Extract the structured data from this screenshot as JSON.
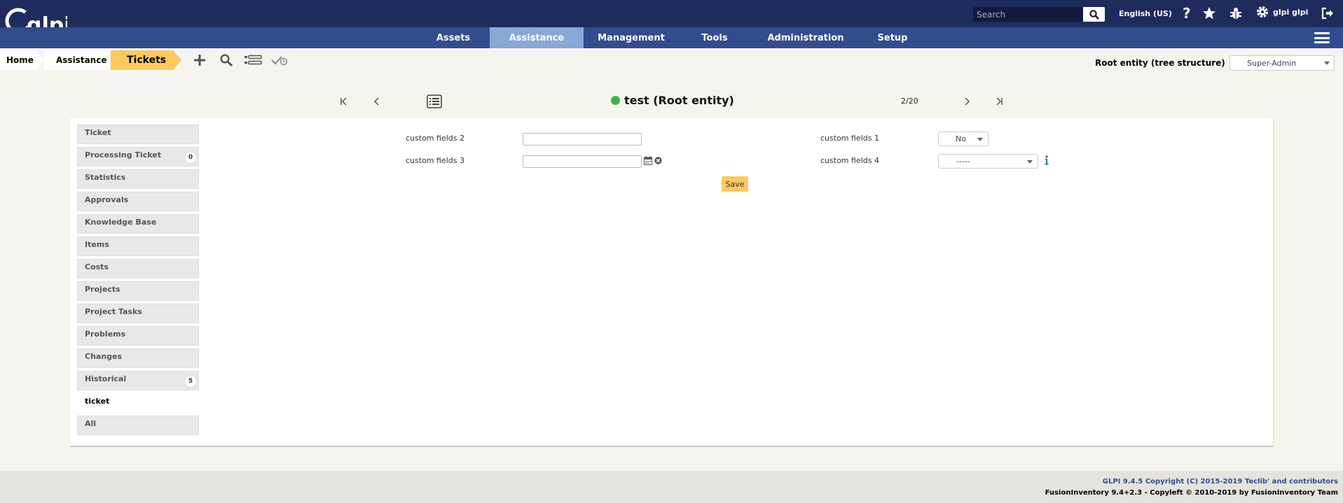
{
  "app": {
    "logo_text": "glpi"
  },
  "top": {
    "search_placeholder": "Search",
    "language": "English (US)",
    "user_name": "glpi glpi"
  },
  "menu": {
    "items": [
      {
        "label": "Assets"
      },
      {
        "label": "Assistance",
        "active": true
      },
      {
        "label": "Management"
      },
      {
        "label": "Tools"
      },
      {
        "label": "Administration"
      },
      {
        "label": "Setup"
      }
    ]
  },
  "breadcrumb": {
    "home": "Home",
    "assistance": "Assistance",
    "tickets": "Tickets"
  },
  "entity": {
    "label": "Root entity (tree structure)",
    "profile": "Super-Admin"
  },
  "record": {
    "title": "test (Root entity)",
    "status_color": "#3cb44b",
    "counter": "2/20"
  },
  "tabs": [
    {
      "label": "Ticket"
    },
    {
      "label": "Processing Ticket",
      "badge": "0"
    },
    {
      "label": "Statistics"
    },
    {
      "label": "Approvals"
    },
    {
      "label": "Knowledge Base"
    },
    {
      "label": "Items"
    },
    {
      "label": "Costs"
    },
    {
      "label": "Projects"
    },
    {
      "label": "Project Tasks"
    },
    {
      "label": "Problems"
    },
    {
      "label": "Changes"
    },
    {
      "label": "Historical",
      "badge": "5"
    },
    {
      "label": "ticket",
      "active": true
    },
    {
      "label": "All"
    }
  ],
  "form": {
    "field2_label": "custom fields 2",
    "field2_value": "",
    "field3_label": "custom fields 3",
    "field3_value": "",
    "field1_label": "custom fields 1",
    "field1_value": "No",
    "field4_label": "custom fields 4",
    "field4_value": "-----",
    "save_label": "Save"
  },
  "footer": {
    "line1": "GLPI 9.4.5 Copyright (C) 2015-2019 Teclib' and contributors",
    "line2": "FusionInventory 9.4+2.3 - Copyleft © 2010-2019 by FusionInventory Team"
  },
  "colors": {
    "topbar": "#1d2c5d",
    "menubar": "#334c8e",
    "menu_active": "#8aa7d6",
    "accent": "#fec95c"
  }
}
